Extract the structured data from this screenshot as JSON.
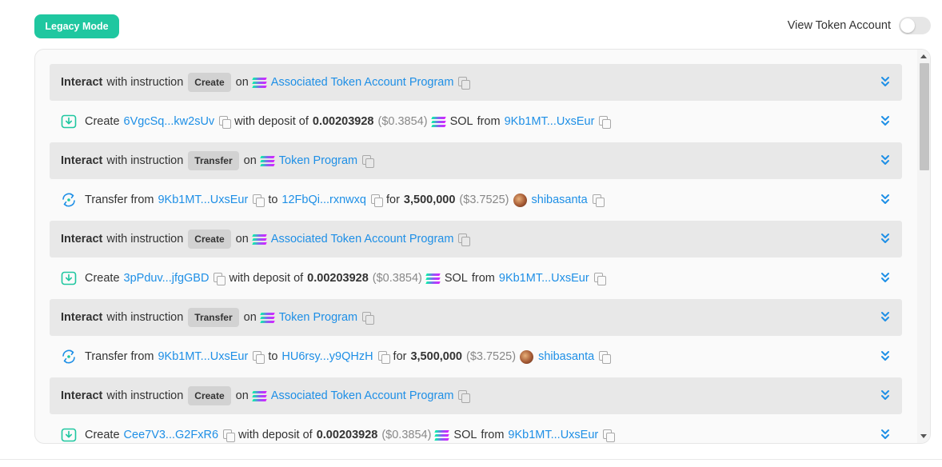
{
  "header": {
    "legacy_mode_label": "Legacy Mode",
    "view_token_account_label": "View Token Account"
  },
  "rows": [
    {
      "kind": "interact",
      "lead": "Interact",
      "mid": "with instruction",
      "instruction": "Create",
      "on": "on",
      "program": "Associated Token Account Program"
    },
    {
      "kind": "create",
      "verb": "Create",
      "account": "6VgcSq...kw2sUv",
      "deposit_text": "with deposit of",
      "amount": "0.00203928",
      "usd": "($0.3854)",
      "token": "SOL",
      "from_text": "from",
      "from": "9Kb1MT...UxsEur"
    },
    {
      "kind": "interact",
      "lead": "Interact",
      "mid": "with instruction",
      "instruction": "Transfer",
      "on": "on",
      "program": "Token Program"
    },
    {
      "kind": "transfer",
      "verb": "Transfer from",
      "from": "9Kb1MT...UxsEur",
      "to_text": "to",
      "to": "12FbQi...rxnwxq",
      "for_text": "for",
      "amount": "3,500,000",
      "usd": "($3.7525)",
      "token": "shibasanta"
    },
    {
      "kind": "interact",
      "lead": "Interact",
      "mid": "with instruction",
      "instruction": "Create",
      "on": "on",
      "program": "Associated Token Account Program"
    },
    {
      "kind": "create",
      "verb": "Create",
      "account": "3pPduv...jfgGBD",
      "deposit_text": "with deposit of",
      "amount": "0.00203928",
      "usd": "($0.3854)",
      "token": "SOL",
      "from_text": "from",
      "from": "9Kb1MT...UxsEur"
    },
    {
      "kind": "interact",
      "lead": "Interact",
      "mid": "with instruction",
      "instruction": "Transfer",
      "on": "on",
      "program": "Token Program"
    },
    {
      "kind": "transfer",
      "verb": "Transfer from",
      "from": "9Kb1MT...UxsEur",
      "to_text": "to",
      "to": "HU6rsy...y9QHzH",
      "for_text": "for",
      "amount": "3,500,000",
      "usd": "($3.7525)",
      "token": "shibasanta"
    },
    {
      "kind": "interact",
      "lead": "Interact",
      "mid": "with instruction",
      "instruction": "Create",
      "on": "on",
      "program": "Associated Token Account Program"
    },
    {
      "kind": "create",
      "verb": "Create",
      "account": "Cee7V3...G2FxR6",
      "deposit_text": "with deposit of",
      "amount": "0.00203928",
      "usd": "($0.3854)",
      "token": "SOL",
      "from_text": "from",
      "from": "9Kb1MT...UxsEur"
    }
  ],
  "colors": {
    "accent": "#1fc7a0",
    "link": "#1e8fe6",
    "row_background": "#e8e8e8",
    "badge_background": "#d2d2d2",
    "muted_text": "#888888"
  },
  "icons": {
    "create": "download-box-icon",
    "transfer": "transfer-arrows-icon",
    "program": "solana-icon",
    "copy": "copy-icon",
    "expand": "double-chevron-down-icon",
    "token": "shibasanta-avatar"
  },
  "toggle_state": "off"
}
